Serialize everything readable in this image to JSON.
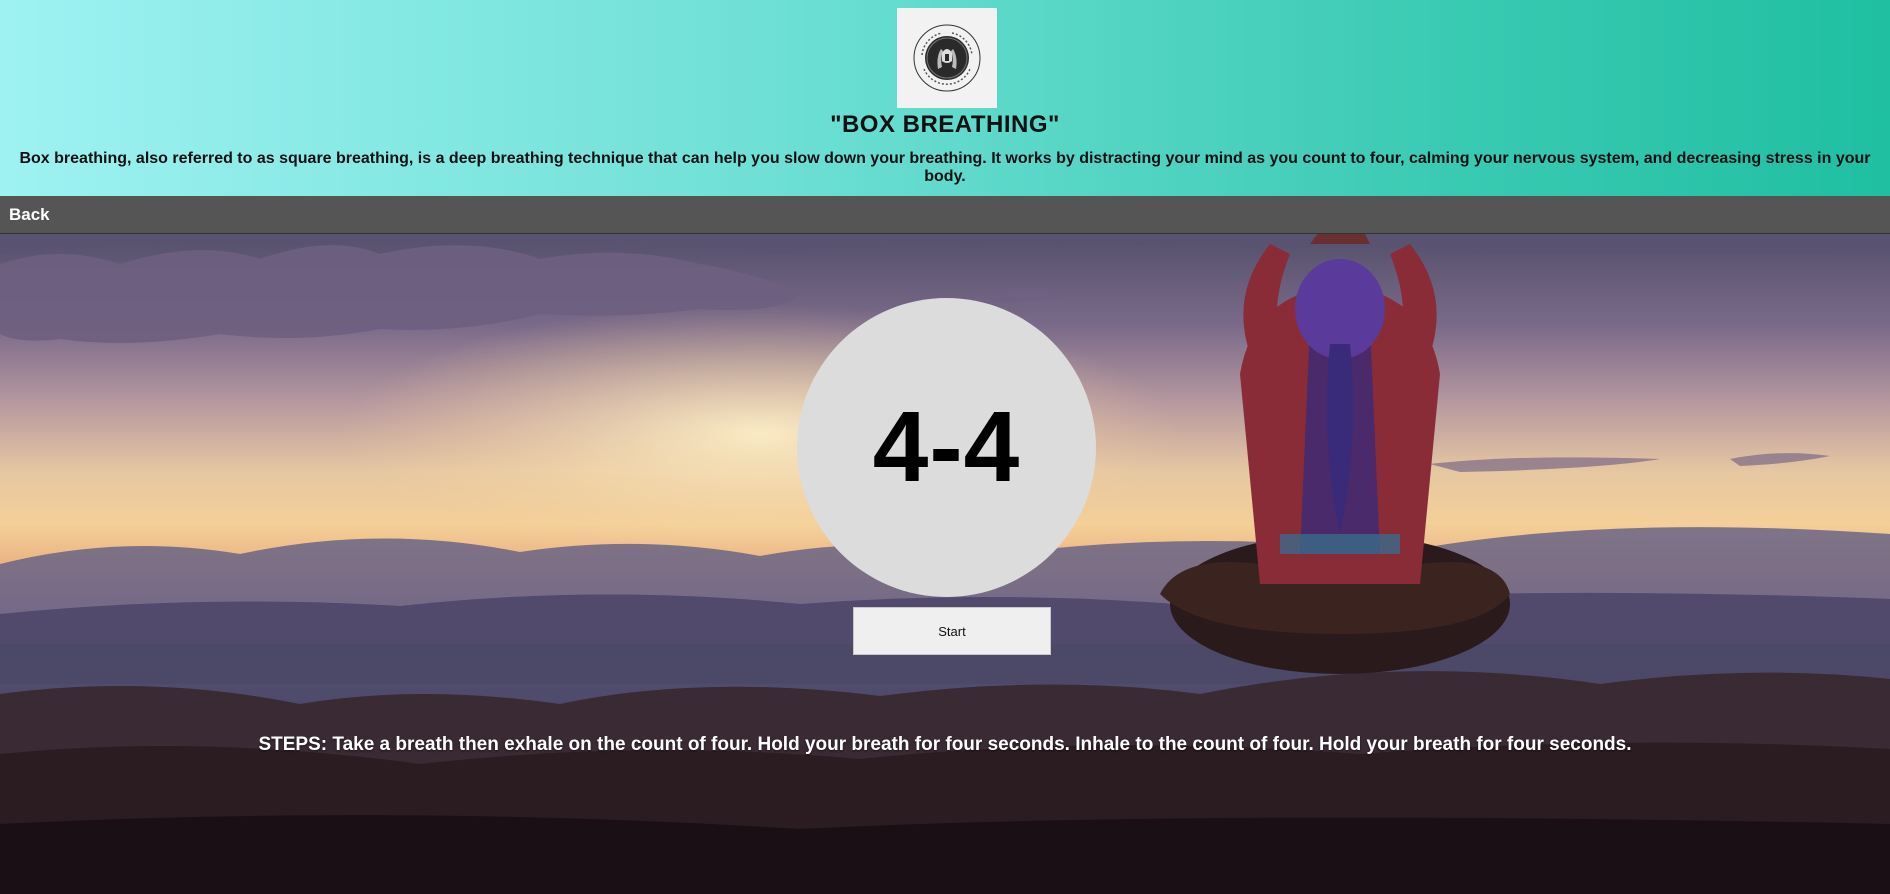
{
  "header": {
    "title": "\"BOX BREATHING\"",
    "description": "Box breathing, also referred to as square breathing, is a deep breathing technique that can help you slow down your breathing. It works by distracting your mind as you count to four, calming your nervous system, and decreasing stress in your body.",
    "logo": {
      "icon": "hands-circle-logo",
      "top_text": "WE CARE",
      "side_text": "DENTAL",
      "bottom_text": "DIGITAL MINDFULNESS"
    }
  },
  "nav": {
    "back_label": "Back"
  },
  "breathing": {
    "counter": "4-4",
    "start_label": "Start",
    "steps": "STEPS: Take a breath then exhale on the count of four. Hold your breath for four seconds. Inhale to the count of four. Hold your breath for four seconds."
  },
  "colors": {
    "header_gradient_start": "#9ef2f2",
    "header_gradient_end": "#1fbfa2",
    "navbar": "#555555",
    "circle": "#dcdcdc",
    "button": "#efefef"
  },
  "background_image": "meditating-woman-at-sunset"
}
